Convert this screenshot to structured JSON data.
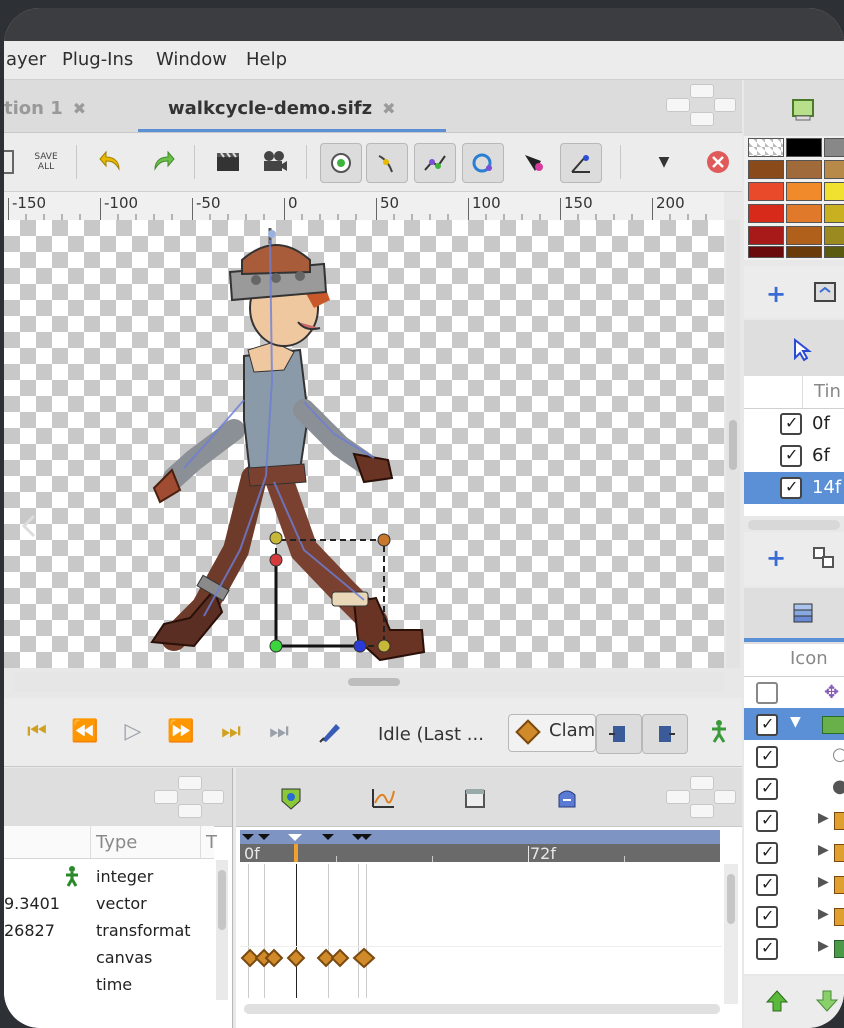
{
  "menu": {
    "items": [
      "ayer",
      "Plug-Ins",
      "Window",
      "Help"
    ]
  },
  "tabs": [
    {
      "label": "tion 1",
      "close": "✖",
      "active": false
    },
    {
      "label": "walkcycle-demo.sifz",
      "close": "✖",
      "active": true
    }
  ],
  "toolbar": {
    "save_all_line1": "SAVE",
    "save_all_line2": "ALL"
  },
  "ruler": {
    "labels": [
      "-150",
      "-100",
      "-50",
      "0",
      "50",
      "100",
      "150",
      "200"
    ]
  },
  "playback": {
    "idle_label": "Idle (Last ...",
    "clamp_label": "Clam"
  },
  "params": {
    "type_header": "Type",
    "t_header": "T",
    "rows": [
      {
        "value": "",
        "type": "integer"
      },
      {
        "value": "9.3401",
        "type": "vector"
      },
      {
        "value": "26827",
        "type": "transformat"
      },
      {
        "value": "",
        "type": "canvas"
      },
      {
        "value": "",
        "type": "time"
      }
    ]
  },
  "timetrack": {
    "label_start": "0f",
    "label_mid": "72f"
  },
  "keyframes": {
    "header": "Tin",
    "rows": [
      {
        "label": "0f",
        "checked": true,
        "selected": false
      },
      {
        "label": "6f",
        "checked": true,
        "selected": false
      },
      {
        "label": "14f",
        "checked": true,
        "selected": true
      }
    ]
  },
  "layers": {
    "header": "Icon"
  },
  "colors": {
    "accent": "#5b8fd6",
    "keyframe": "#d08a2a",
    "waypoint_edge": "#7a4a10"
  }
}
